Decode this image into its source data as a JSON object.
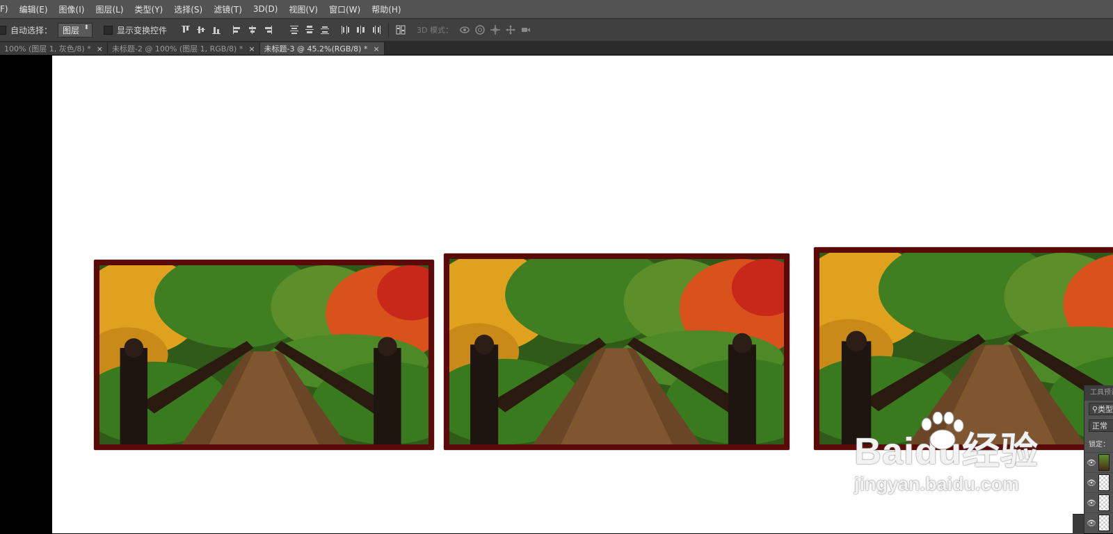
{
  "menu": [
    "F)",
    "编辑(E)",
    "图像(I)",
    "图层(L)",
    "类型(Y)",
    "选择(S)",
    "滤镜(T)",
    "3D(D)",
    "视图(V)",
    "窗口(W)",
    "帮助(H)"
  ],
  "options": {
    "auto_select_label": "自动选择：",
    "auto_select_value": "图层",
    "show_transform_label": "显示变换控件",
    "mode_label": "3D 模式："
  },
  "tabs": [
    {
      "label": "100% (图层 1, 灰色/8) *",
      "close": "×",
      "active": false
    },
    {
      "label": "未标题-2 @ 100% (图层 1, RGB/8) *",
      "close": "×",
      "active": false
    },
    {
      "label": "未标题-3 @ 45.2%(RGB/8) *",
      "close": "×",
      "active": true
    }
  ],
  "panel": {
    "header": "工具预设",
    "search_label": "类型",
    "blend_mode": "正常",
    "lock_label": "锁定："
  },
  "watermark": {
    "brand": "Baidu经验",
    "url": "jingyan.baidu.com"
  },
  "colors": {
    "frame": "#5b0a0a",
    "canvas": "#ffffff",
    "menubar": "#535353",
    "optionsbar": "#404040"
  }
}
